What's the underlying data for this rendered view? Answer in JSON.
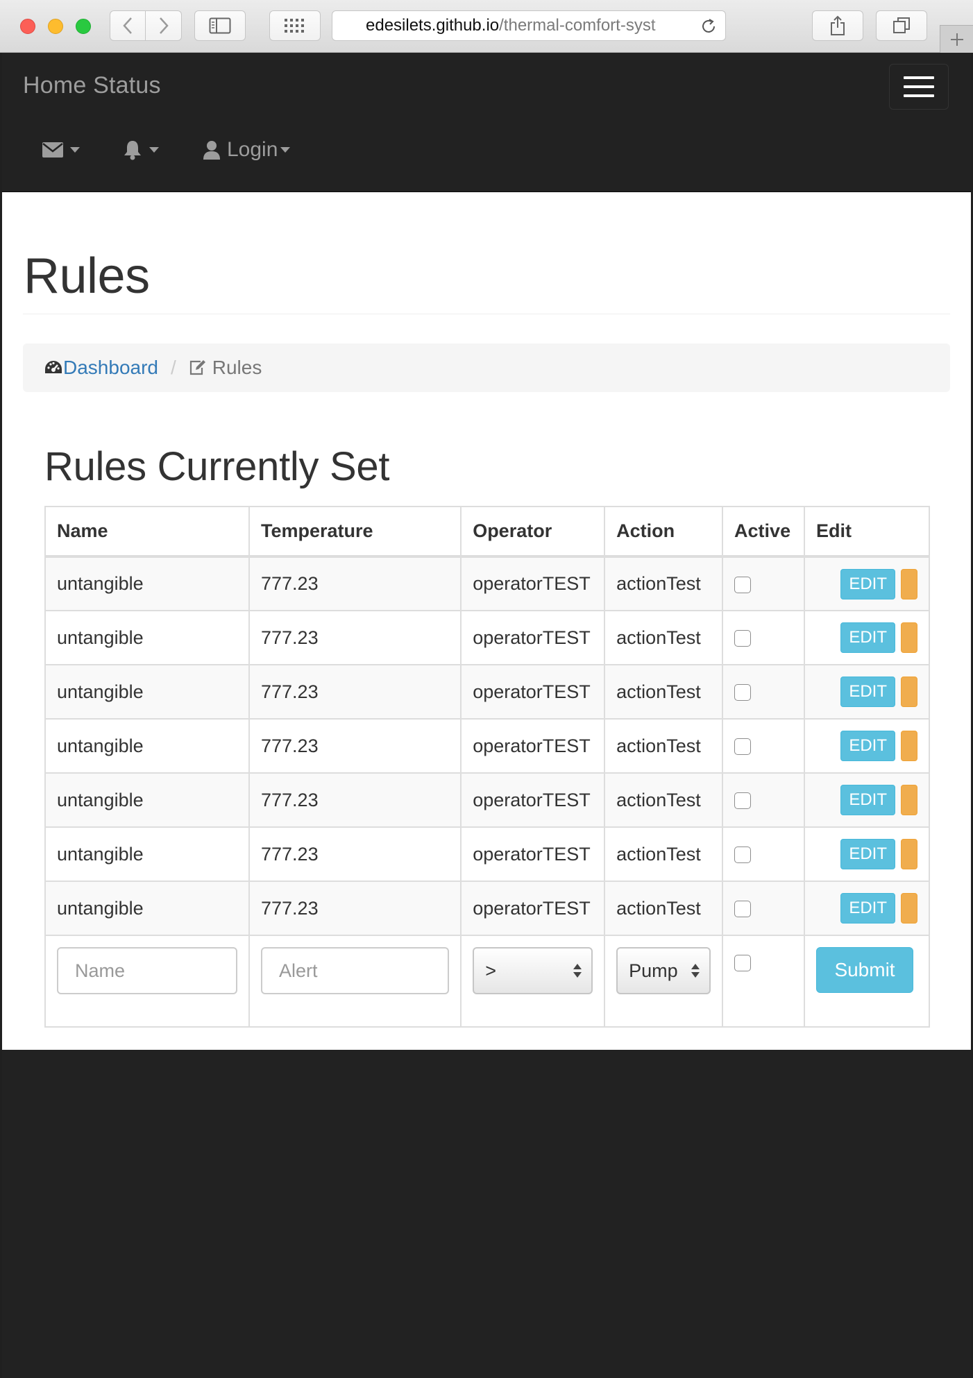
{
  "browser": {
    "url_host": "edesilets.github.io",
    "url_path": "/thermal-comfort-syst"
  },
  "navbar": {
    "brand": "Home Status",
    "login_label": "Login"
  },
  "page": {
    "title": "Rules",
    "breadcrumb": {
      "home": "Dashboard",
      "current": "Rules"
    },
    "section_title": "Rules Currently Set"
  },
  "table": {
    "headers": {
      "name": "Name",
      "temperature": "Temperature",
      "operator": "Operator",
      "action": "Action",
      "active": "Active",
      "edit": "Edit"
    },
    "rows": [
      {
        "name": "untangible",
        "temperature": "777.23",
        "operator": "operatorTEST",
        "action": "actionTest",
        "active": false,
        "edit_label": "EDIT"
      },
      {
        "name": "untangible",
        "temperature": "777.23",
        "operator": "operatorTEST",
        "action": "actionTest",
        "active": false,
        "edit_label": "EDIT"
      },
      {
        "name": "untangible",
        "temperature": "777.23",
        "operator": "operatorTEST",
        "action": "actionTest",
        "active": false,
        "edit_label": "EDIT"
      },
      {
        "name": "untangible",
        "temperature": "777.23",
        "operator": "operatorTEST",
        "action": "actionTest",
        "active": false,
        "edit_label": "EDIT"
      },
      {
        "name": "untangible",
        "temperature": "777.23",
        "operator": "operatorTEST",
        "action": "actionTest",
        "active": false,
        "edit_label": "EDIT"
      },
      {
        "name": "untangible",
        "temperature": "777.23",
        "operator": "operatorTEST",
        "action": "actionTest",
        "active": false,
        "edit_label": "EDIT"
      },
      {
        "name": "untangible",
        "temperature": "777.23",
        "operator": "operatorTEST",
        "action": "actionTest",
        "active": false,
        "edit_label": "EDIT"
      }
    ],
    "form": {
      "name_placeholder": "Name",
      "alert_placeholder": "Alert",
      "operator_selected": ">",
      "action_selected": "Pump",
      "active": false,
      "submit_label": "Submit"
    }
  },
  "colors": {
    "navbar_bg": "#222222",
    "nav_text": "#9d9d9d",
    "link": "#337ab7",
    "info_button": "#5bc0de",
    "warning_button": "#f0ad4e"
  },
  "icons": {
    "mail": "envelope-icon",
    "bell": "bell-icon",
    "user": "user-icon",
    "dashboard": "dashboard-icon",
    "rules": "edit-icon"
  }
}
